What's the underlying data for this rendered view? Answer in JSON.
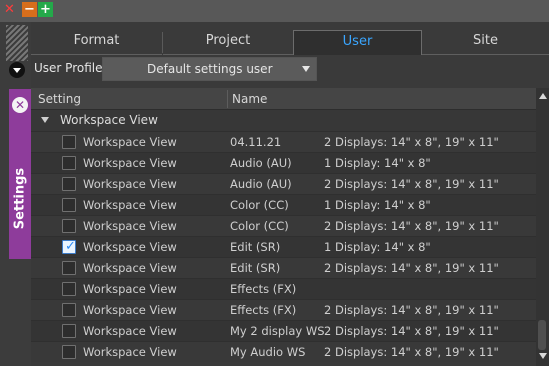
{
  "window": {
    "close_glyph": "✕",
    "minimize_glyph": "−",
    "maximize_glyph": "+"
  },
  "rail": {
    "settings_label": "Settings",
    "close_glyph": "✕"
  },
  "tabs": [
    {
      "label": "Format",
      "active": false
    },
    {
      "label": "Project",
      "active": false
    },
    {
      "label": "User",
      "active": true
    },
    {
      "label": "Site",
      "active": false
    }
  ],
  "profile": {
    "label": "User Profile:",
    "value": "Default settings user"
  },
  "table": {
    "headers": {
      "setting": "Setting",
      "name": "Name"
    },
    "group": "Workspace View",
    "rows": [
      {
        "setting": "Workspace View",
        "name": "04.11.21",
        "desc": "2 Displays: 14\" x 8\", 19\" x 11\"",
        "checked": false
      },
      {
        "setting": "Workspace View",
        "name": "Audio (AU)",
        "desc": "1 Display: 14\" x 8\"",
        "checked": false
      },
      {
        "setting": "Workspace View",
        "name": "Audio (AU)",
        "desc": "2 Displays: 14\" x 8\", 19\" x 11\"",
        "checked": false
      },
      {
        "setting": "Workspace View",
        "name": "Color (CC)",
        "desc": "1 Display: 14\" x 8\"",
        "checked": false
      },
      {
        "setting": "Workspace View",
        "name": "Color (CC)",
        "desc": "2 Displays: 14\" x 8\", 19\" x 11\"",
        "checked": false
      },
      {
        "setting": "Workspace View",
        "name": "Edit (SR)",
        "desc": "1 Display: 14\" x 8\"",
        "checked": true
      },
      {
        "setting": "Workspace View",
        "name": "Edit (SR)",
        "desc": "2 Displays: 14\" x 8\", 19\" x 11\"",
        "checked": false
      },
      {
        "setting": "Workspace View",
        "name": "Effects (FX)",
        "desc": "",
        "checked": false
      },
      {
        "setting": "Workspace View",
        "name": "Effects (FX)",
        "desc": "2 Displays: 14\" x 8\", 19\" x 11\"",
        "checked": false
      },
      {
        "setting": "Workspace View",
        "name": "My 2 display WS",
        "desc": "2 Displays: 14\" x 8\", 19\" x 11\"",
        "checked": false
      },
      {
        "setting": "Workspace View",
        "name": "My Audio WS",
        "desc": "2 Displays: 14\" x 8\", 19\" x 11\"",
        "checked": false
      }
    ]
  },
  "colors": {
    "accent": "#3aa6ff",
    "settings_tab": "#8e3c9b",
    "close": "#ff3b3b",
    "minimize": "#d76e1c",
    "maximize": "#24a94a"
  }
}
